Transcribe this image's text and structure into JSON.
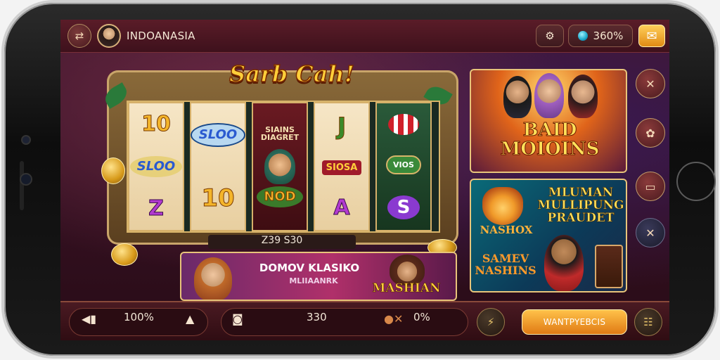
{
  "header": {
    "back_icon": "swap-arrows-icon",
    "username": "INDOANASIA",
    "settings_icon": "gear-heart-icon",
    "balance_percent": "360%",
    "mail_icon": "mail-icon"
  },
  "slot": {
    "title": "Sarb Cah!",
    "reel1": [
      "10",
      "SLOO",
      "Z"
    ],
    "reel2": [
      "SLOO",
      "10"
    ],
    "reel3": [
      "SIAINS DIAGRET",
      "NOD"
    ],
    "reel4": [
      "J",
      "SIOSA",
      "A"
    ],
    "reel5": [
      "VIOS",
      "S"
    ],
    "win_amount": "Z39 S30"
  },
  "promo_cards": {
    "baid_title": "BAID MOIOINS",
    "mlu_title": "MLUMAN MULLIPUNG PRAUDET",
    "mlu_subtitle": "NASHOX",
    "mlu_bottom": "SAMEV NASHINS",
    "promo_title": "DOMOV KLASIKO",
    "promo_sub": "MLIIAANRK",
    "promo_tag": "MASHIAN"
  },
  "bottom_bar": {
    "volume_percent": "100%",
    "bet_value": "330",
    "extra_percent": "0%",
    "action_label": "WANTPYEBCIS"
  }
}
